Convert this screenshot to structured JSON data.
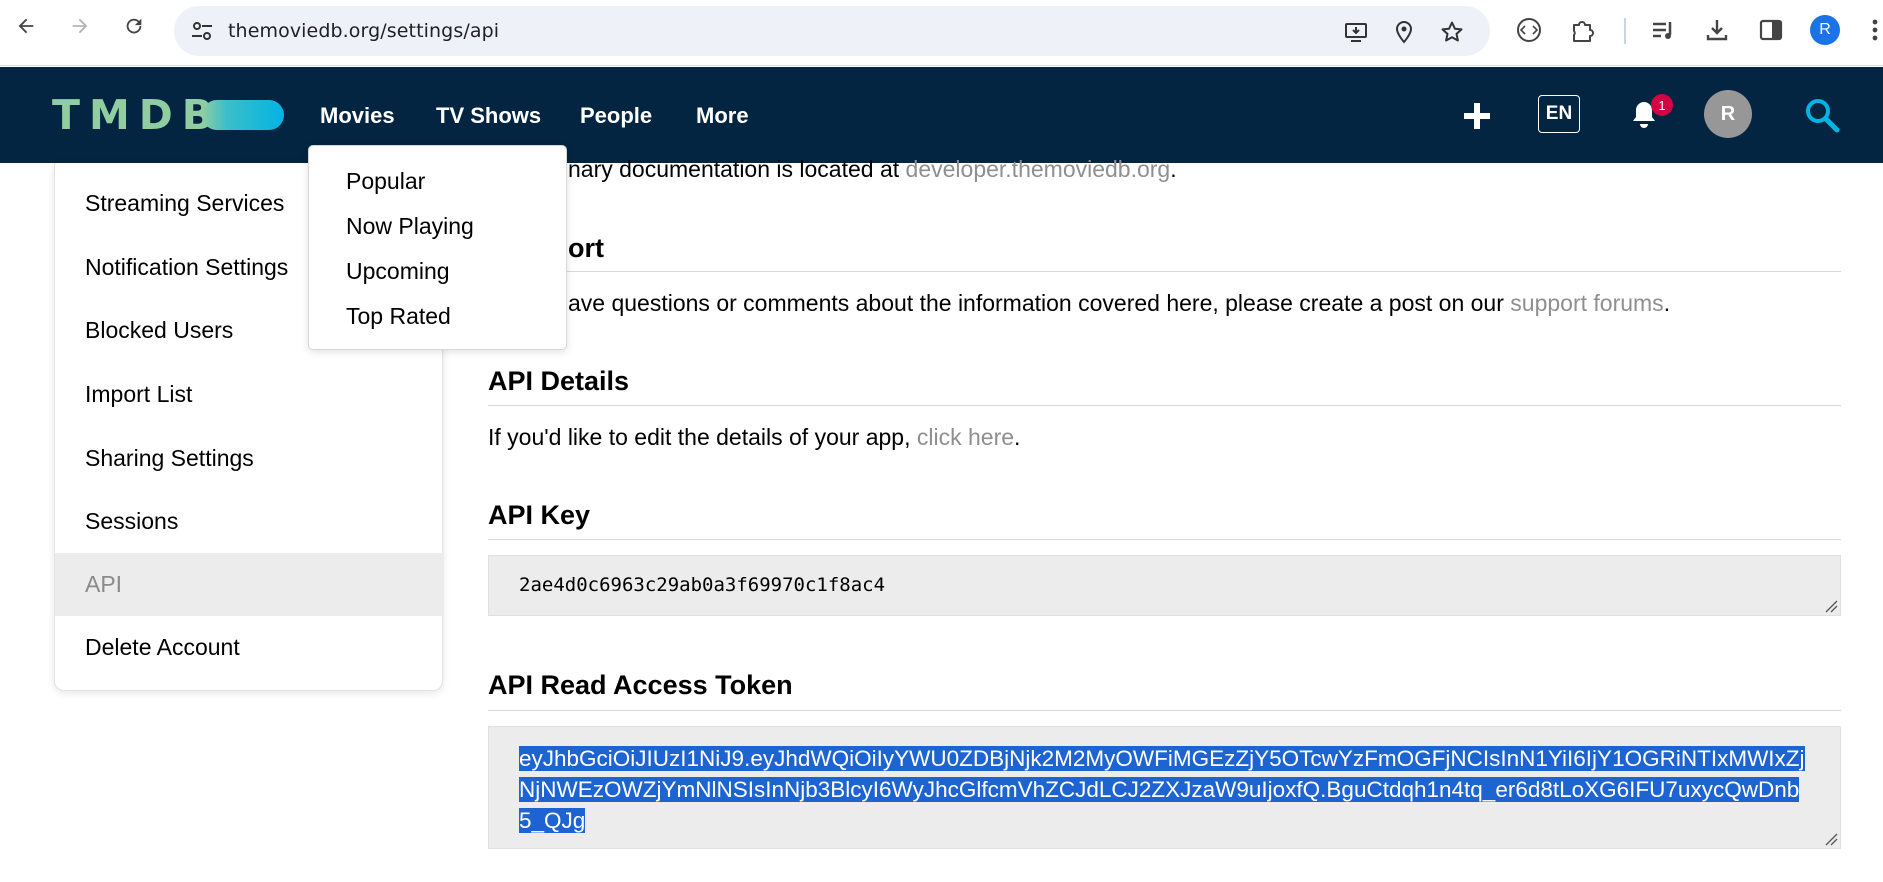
{
  "browser": {
    "url": "themoviedb.org/settings/api",
    "profile_initial": "R"
  },
  "header": {
    "logo": "TMDB",
    "nav": [
      "Movies",
      "TV Shows",
      "People",
      "More"
    ],
    "language": "EN",
    "notifications_count": "1",
    "avatar_initial": "R",
    "colors": {
      "background": "#032541",
      "logo": "#90cea1",
      "accent": "#01b4e4",
      "badge": "#d40242"
    }
  },
  "movies_menu": {
    "items": [
      "Popular",
      "Now Playing",
      "Upcoming",
      "Top Rated"
    ]
  },
  "sidebar": {
    "items": [
      {
        "label": "Streaming Services",
        "active": false
      },
      {
        "label": "Notification Settings",
        "active": false
      },
      {
        "label": "Blocked Users",
        "active": false
      },
      {
        "label": "Import List",
        "active": false
      },
      {
        "label": "Sharing Settings",
        "active": false
      },
      {
        "label": "Sessions",
        "active": false
      },
      {
        "label": "API",
        "active": true
      },
      {
        "label": "Delete Account",
        "active": false
      }
    ]
  },
  "main": {
    "docs_prefix": "nary documentation is located at ",
    "docs_link": "developer.themoviedb.org",
    "docs_suffix": ".",
    "support_heading": "ort",
    "support_prefix": "ave questions or comments about the information covered here, please create a post on our ",
    "support_link": "support forums",
    "support_suffix": ".",
    "api_details_heading": "API Details",
    "api_details_prefix": "If you'd like to edit the details of your app, ",
    "api_details_link": "click here",
    "api_details_suffix": ".",
    "api_key_heading": "API Key",
    "api_key_value": "2ae4d0c6963c29ab0a3f69970c1f8ac4",
    "token_heading": "API Read Access Token",
    "token_value": "eyJhbGciOiJIUzI1NiJ9.eyJhdWQiOiIyYWU0ZDBjNjk2M2MyOWFiMGEzZjY5OTcwYzFmOGFjNCIsInN1YiI6IjY1OGRiNTIxMWIxZjNjNWEzOWZjYmNlNSIsInNjb3BlcyI6WyJhcGlfcmVhZCJdLCJ2ZXJzaW9uIjoxfQ.BguCtdqh1n4tq_er6d8tLoXG6IFU7uxycQwDnb5_QJg"
  }
}
